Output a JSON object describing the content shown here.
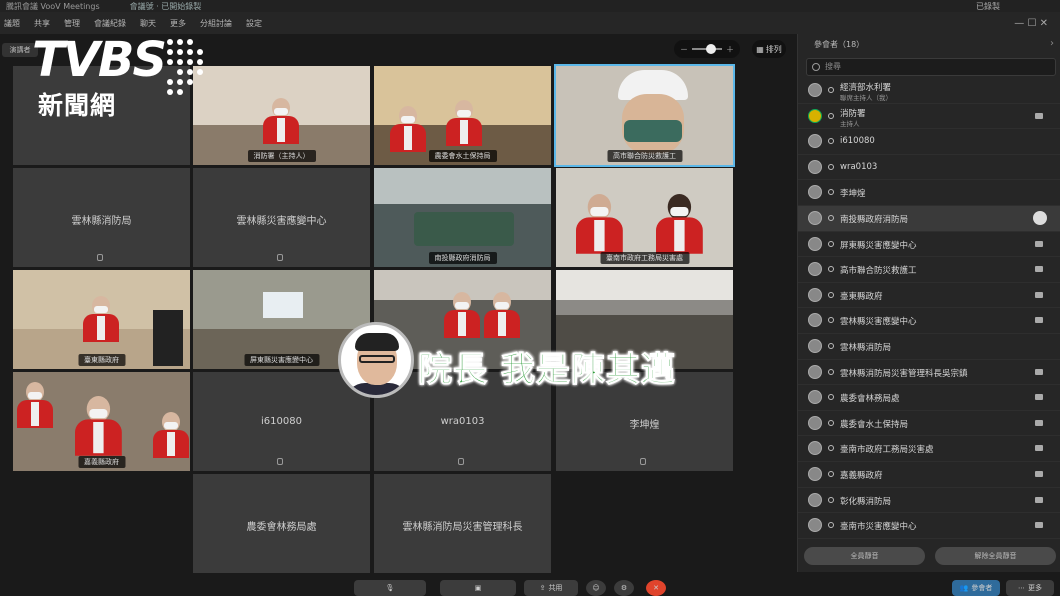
{
  "topbar": {
    "left": "騰訊會議 VooV Meetings",
    "center": "會議號 · 已開始錄製",
    "right": "已錄製"
  },
  "menubar": {
    "items": [
      "議題",
      "共享",
      "管理",
      "會議紀錄",
      "聊天",
      "更多",
      "分組討論",
      "設定"
    ],
    "right": "— ☐ ✕"
  },
  "view_tab": "演講者",
  "logo": {
    "word": "TVBS",
    "sub": "新聞網"
  },
  "view_controls": {
    "layout_label": "排列"
  },
  "tiles": [
    {
      "name": "",
      "caption": "",
      "tag": ""
    },
    {
      "name": "",
      "caption": "消防署（主持人）",
      "tag": ""
    },
    {
      "name": "",
      "caption": "農委會水土保持局",
      "tag": ""
    },
    {
      "name": "",
      "caption": "高市聯合防災救護工",
      "tag": ""
    },
    {
      "name": "雲林縣消防局",
      "caption": "",
      "tag": ""
    },
    {
      "name": "雲林縣災害應變中心",
      "caption": "",
      "tag": ""
    },
    {
      "name": "",
      "caption": "南投縣政府消防局",
      "tag": ""
    },
    {
      "name": "",
      "caption": "臺南市政府工務局災害處",
      "tag": ""
    },
    {
      "name": "",
      "caption": "臺東縣政府",
      "tag": ""
    },
    {
      "name": "",
      "caption": "屏東縣災害應變中心",
      "tag": ""
    },
    {
      "name": "",
      "caption": "",
      "tag": ""
    },
    {
      "name": "",
      "caption": "",
      "tag": ""
    },
    {
      "name": "",
      "caption": "嘉義縣政府",
      "tag": ""
    },
    {
      "name": "i610080",
      "caption": "",
      "tag": ""
    },
    {
      "name": "wra0103",
      "caption": "",
      "tag": ""
    },
    {
      "name": "李坤煌",
      "caption": "",
      "tag": ""
    },
    {
      "name": "農委會林務局處",
      "caption": "",
      "tag": ""
    },
    {
      "name": "雲林縣消防局災害管理科長",
      "caption": "",
      "tag": ""
    }
  ],
  "overlay": {
    "text": "院長  我是陳其邁"
  },
  "panel": {
    "title": "參會者（18）",
    "search_placeholder": "搜尋",
    "footer_left": "全員靜音",
    "footer_right": "解除全員靜音",
    "participants": [
      {
        "name": "經濟部水利署",
        "role": "聯席主持人（我）"
      },
      {
        "name": "消防署",
        "role": "主持人"
      },
      {
        "name": "i610080",
        "role": ""
      },
      {
        "name": "wra0103",
        "role": ""
      },
      {
        "name": "李坤煌",
        "role": ""
      },
      {
        "name": "南投縣政府消防局",
        "role": ""
      },
      {
        "name": "屏東縣災害應變中心",
        "role": ""
      },
      {
        "name": "高市聯合防災救護工",
        "role": ""
      },
      {
        "name": "臺東縣政府",
        "role": ""
      },
      {
        "name": "雲林縣災害應變中心",
        "role": ""
      },
      {
        "name": "雲林縣消防局",
        "role": ""
      },
      {
        "name": "雲林縣消防局災害管理科長吳宗鎮",
        "role": ""
      },
      {
        "name": "農委會林務局處",
        "role": ""
      },
      {
        "name": "農委會水土保持局",
        "role": ""
      },
      {
        "name": "臺南市政府工務局災害處",
        "role": ""
      },
      {
        "name": "嘉義縣政府",
        "role": ""
      },
      {
        "name": "彰化縣消防局",
        "role": ""
      },
      {
        "name": "臺南市災害應變中心",
        "role": ""
      }
    ]
  },
  "toolbar": {
    "share": "共用",
    "participants_btn": "參會者",
    "more": "更多"
  }
}
